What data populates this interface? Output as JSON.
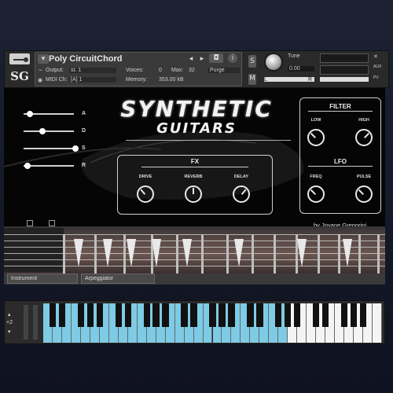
{
  "header": {
    "instrument_name": "Poly CircuitChord",
    "output_label": "Output:",
    "output_value": "st. 1",
    "midi_label": "MIDI Ch:",
    "midi_value": "[A]  1",
    "voices_label": "Voices:",
    "voices_value": "0",
    "max_label": "Max:",
    "max_value": "32",
    "memory_label": "Memory:",
    "memory_value": "353.00 kB",
    "purge_label": "Purge",
    "tune_label": "Tune",
    "tune_value": "0.00",
    "s_label": "S",
    "m_label": "M",
    "aux_label": "AUX",
    "pv_label": "PV",
    "l_label": "L",
    "r_label": "R"
  },
  "logo": {
    "text": "SG"
  },
  "title": {
    "line1": "SYNTHETIC",
    "line2": "GUITARS"
  },
  "envelope": {
    "sliders": [
      {
        "label": "A",
        "level": 0.1
      },
      {
        "label": "D",
        "level": 0.35
      },
      {
        "label": "S",
        "level": 1.0
      },
      {
        "label": "R",
        "level": 0.05
      }
    ]
  },
  "fx": {
    "title": "FX",
    "knobs": [
      {
        "label": "DRIVE",
        "angle": -40
      },
      {
        "label": "REVERB",
        "angle": 0
      },
      {
        "label": "DELAY",
        "angle": 40
      }
    ]
  },
  "filter": {
    "title": "FILTER",
    "knobs": [
      {
        "label": "LOW",
        "angle": -45
      },
      {
        "label": "HIGH",
        "angle": 45
      }
    ]
  },
  "lfo": {
    "title": "LFO",
    "knobs": [
      {
        "label": "FREQ",
        "angle": -45
      },
      {
        "label": "PULSE",
        "angle": -45
      }
    ]
  },
  "credit": "by Jovane Gregorini",
  "tabs": [
    "Instrument",
    "Arpeggiator"
  ],
  "keyboard": {
    "octave": "+2",
    "highlight_color": "#7ecbe6"
  }
}
